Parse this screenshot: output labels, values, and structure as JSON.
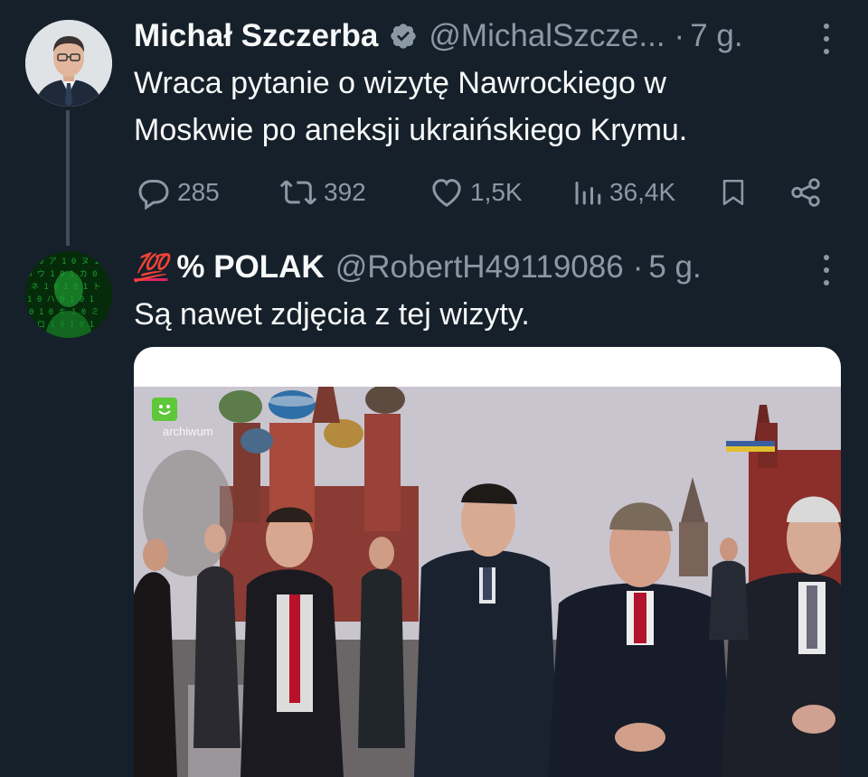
{
  "tweet1": {
    "name": "Michał Szczerba",
    "handle": "@MichalSzcze...",
    "dot": "·",
    "time": "7 g.",
    "text_line1": "Wraca pytanie o wizytę Nawrockiego w",
    "text_line2": "Moskwie po aneksji ukraińskiego Krymu.",
    "replies": "285",
    "retweets": "392",
    "likes": "1,5K",
    "views": "36,4K"
  },
  "tweet2": {
    "emoji": "💯",
    "name": "% POLAK",
    "handle": "@RobertH49119086",
    "dot": "·",
    "time": "5 g.",
    "text": "Są nawet zdjęcia z tej wizyty."
  },
  "media": {
    "watermark": "archiwum"
  },
  "colors": {
    "background": "#16202a",
    "text": "#f7f9f9",
    "muted": "#8b98a5",
    "verified": "#8b98a5"
  }
}
